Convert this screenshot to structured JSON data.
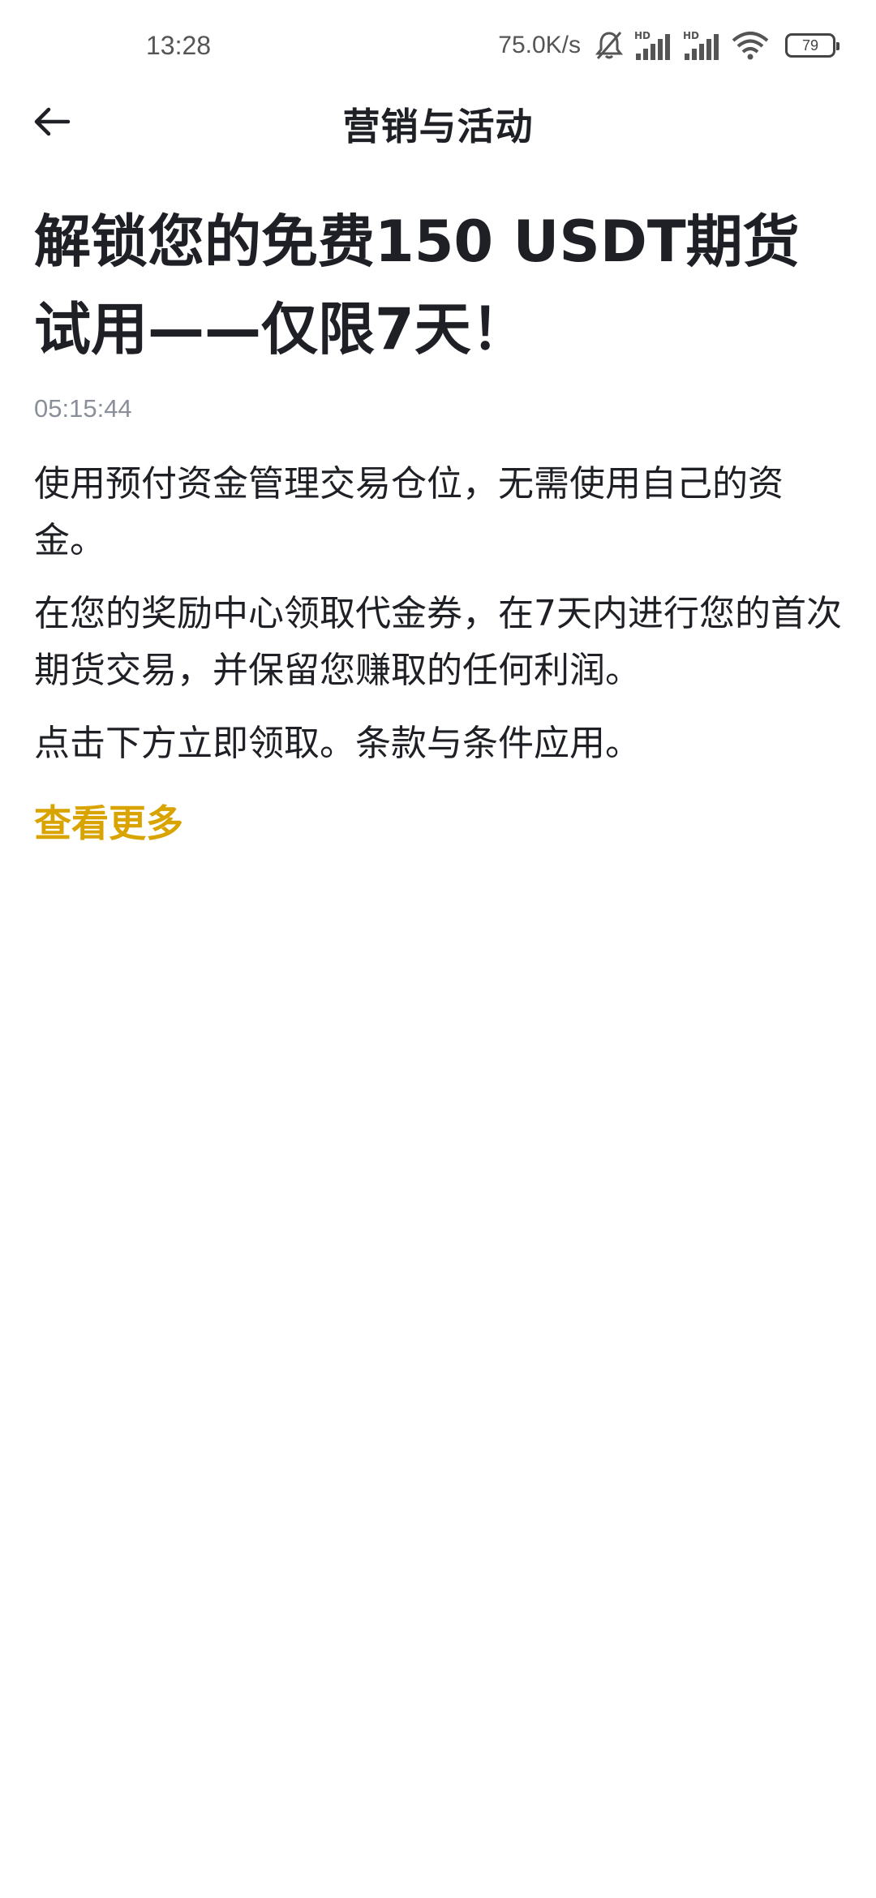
{
  "status_bar": {
    "time": "13:28",
    "net_speed": "75.0K/s",
    "battery": "79",
    "icons": [
      "bell-muted-icon",
      "signal-hd-icon",
      "signal-hd-icon",
      "wifi-icon",
      "battery-icon"
    ]
  },
  "header": {
    "back_icon": "back-arrow-icon",
    "title": "营销与活动"
  },
  "article": {
    "title": "解锁您的免费150 USDT期货试用——仅限7天！",
    "time": "05:15:44",
    "paragraphs": [
      "使用预付资金管理交易仓位，无需使用自己的资金。",
      "在您的奖励中心领取代金券，在7天内进行您的首次期货交易，并保留您赚取的任何利润。",
      "点击下方立即领取。条款与条件应用。"
    ],
    "see_more": "查看更多"
  },
  "colors": {
    "text": "#1e2026",
    "muted": "#8a8f99",
    "accent": "#d9a400",
    "background": "#ffffff"
  }
}
